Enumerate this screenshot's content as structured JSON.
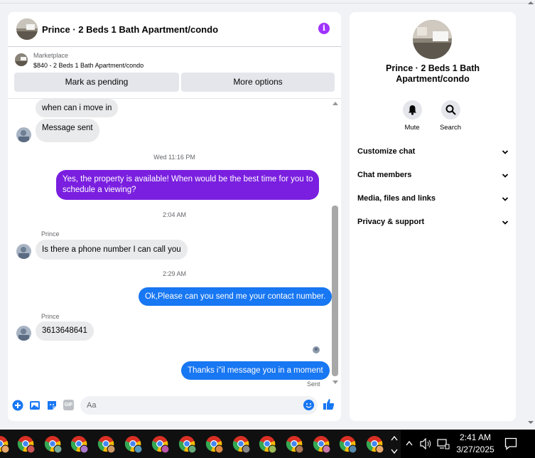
{
  "chat": {
    "title": "Prince · 2 Beds 1 Bath Apartment/condo",
    "info_glyph": "i",
    "marketplace_label": "Marketplace",
    "listing": "$840 - 2 Beds 1 Bath Apartment/condo",
    "mark_pending": "Mark as pending",
    "more_options": "More options",
    "messages": {
      "m1": "when can i move in",
      "m2": "Message sent",
      "ts1": "Wed 11:16 PM",
      "m3_line1": "Yes, the property is available! When would be the best time for you to",
      "m3_line2": "schedule a viewing?",
      "ts2": "2:04 AM",
      "sender1": "Prince",
      "m4": "Is there a phone number I can call you",
      "ts3": "2:29 AM",
      "m5": "Ok,Please can you send me your contact number.",
      "sender2": "Prince",
      "m6": "3613648641",
      "m7": "Thanks i\"il message you in a moment",
      "status": "Sent"
    },
    "composer_placeholder": "Aa",
    "gif_label": "GIF"
  },
  "info": {
    "title_line1": "Prince · 2 Beds 1 Bath",
    "title_line2": "Apartment/condo",
    "mute": "Mute",
    "search": "Search",
    "menu": [
      "Customize chat",
      "Chat members",
      "Media, files and links",
      "Privacy & support"
    ]
  },
  "taskbar": {
    "time": "2:41 AM",
    "date": "3/27/2025"
  },
  "colors": {
    "accent_blue": "#1877f2",
    "purple_bubble": "#7a1fe0",
    "info_purple": "#a033ff"
  }
}
